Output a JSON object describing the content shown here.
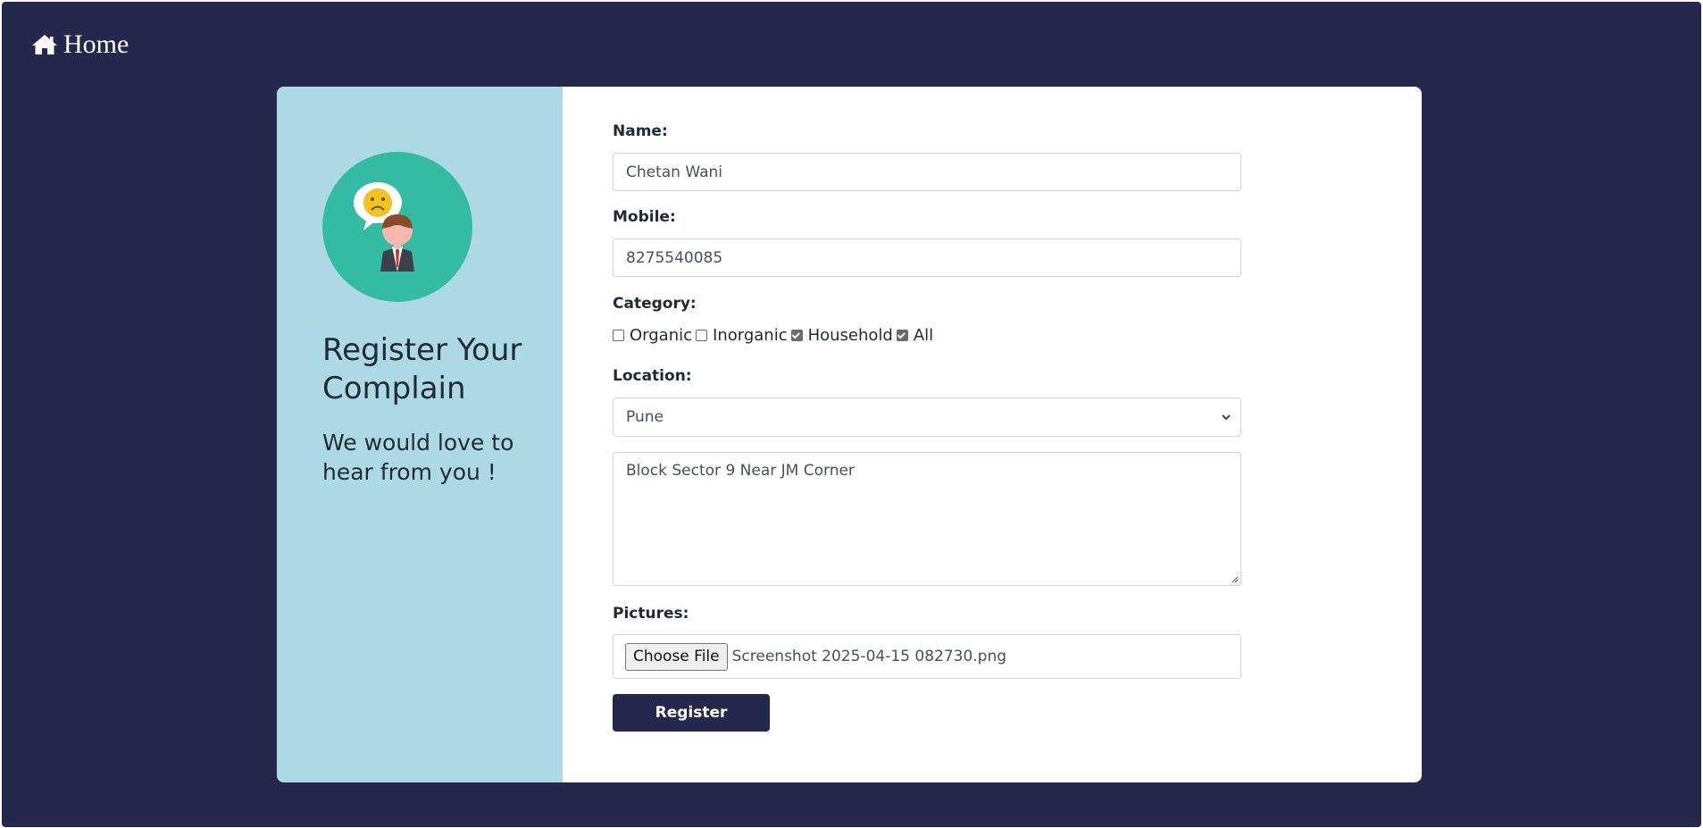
{
  "nav": {
    "home_icon": "home-icon",
    "home_label": "Home"
  },
  "left_panel": {
    "title": "Register Your Complain",
    "subtitle": "We would love to hear from you !"
  },
  "form": {
    "name_label": "Name:",
    "name_value": "Chetan Wani",
    "mobile_label": "Mobile:",
    "mobile_value": "8275540085",
    "category_label": "Category:",
    "categories": [
      {
        "label": "Organic",
        "checked": false
      },
      {
        "label": "Inorganic",
        "checked": false
      },
      {
        "label": "Household",
        "checked": true
      },
      {
        "label": "All",
        "checked": true
      }
    ],
    "location_label": "Location:",
    "location_selected": "Pune",
    "address_value": "Block Sector 9 Near JM Corner",
    "pictures_label": "Pictures:",
    "choose_file_label": "Choose File",
    "file_name": "Screenshot 2025-04-15 082730.png",
    "submit_label": "Register"
  },
  "colors": {
    "page_bg": "#25274d",
    "left_panel_bg": "#add8e6",
    "avatar_bg": "#33bba4",
    "button_bg": "#25274d"
  }
}
